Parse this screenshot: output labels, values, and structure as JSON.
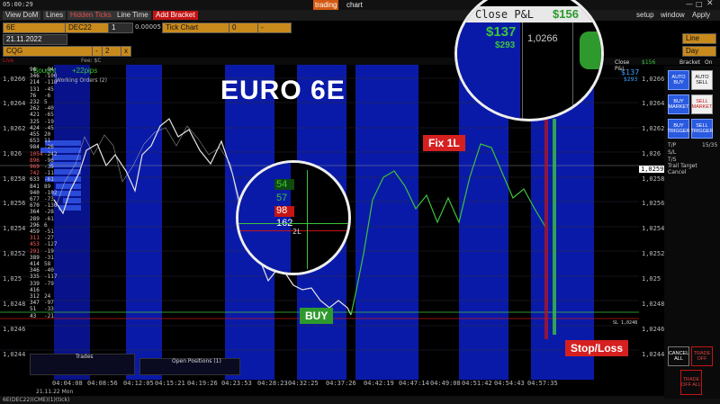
{
  "top": {
    "clock": "05:00:29",
    "brand_a": "trading",
    "brand_b": "chart"
  },
  "menu": {
    "tabs": [
      "View DoM",
      "Lines",
      "Hidden Ticks",
      "Line Time"
    ],
    "add_bracket": "Add Bracket",
    "right": [
      "setup",
      "window",
      "Apply"
    ]
  },
  "toolbar": {
    "symbol": "6E",
    "contract": "DEC22",
    "qty": "1",
    "tick_size": "0.00005",
    "chart_type": "Tick Chart",
    "offset": "0",
    "date": "21.11.2022",
    "account": "CQG",
    "dash": "-",
    "two": "2",
    "line_sel": "Line",
    "day_sel": "Day",
    "x_close": "x"
  },
  "status_line": {
    "live": "Live",
    "fee": "Fee: $C"
  },
  "chart": {
    "watermark": "EURO 6E",
    "bought_label": "Bought",
    "pips": "+22pips",
    "working_orders": "Working Orders (2)",
    "price_labels": [
      "1,0266",
      "1,0264",
      "1,0262",
      "1,026",
      "1,0258",
      "1,0256",
      "1,0254",
      "1,0252",
      "1,025",
      "1,0248",
      "1,0246",
      "1,0244"
    ],
    "current_price": "1,0259",
    "time_labels": [
      "04:04:08",
      "04:08:56",
      "04:12:05",
      "04:15:21",
      "04:19:26",
      "04:23:53",
      "04:28:23",
      "04:32:25",
      "04:37:26",
      "04:42:19",
      "04:47:14",
      "04:49:08",
      "04:51:42",
      "04:54:43",
      "04:57:35"
    ],
    "bottom_date": "21.11.22 Mon",
    "bottom_status": "6E(DEC22)(CME)(1)(tick)",
    "trades_label": "Trades",
    "open_positions": "Open Positions (1)",
    "close_pl_small": "Close P&L",
    "close_pl_small_val": "$156",
    "pl_small_a": "$137",
    "pl_small_b": "$293",
    "bracket_label": "Bracket",
    "on_label": "On",
    "stop_right": "SL 1,0248",
    "tp_right": "1,0248"
  },
  "dom": [
    {
      "p": "96",
      "v": "-94"
    },
    {
      "p": "346",
      "v": "-100"
    },
    {
      "p": "214",
      "v": "-118"
    },
    {
      "p": "131",
      "v": "-45"
    },
    {
      "p": "76",
      "v": "-6"
    },
    {
      "p": "232",
      "v": "5"
    },
    {
      "p": "262",
      "v": "-40"
    },
    {
      "p": "421",
      "v": "-65"
    },
    {
      "p": "325",
      "v": "-19"
    },
    {
      "p": "424",
      "v": "-45"
    },
    {
      "p": "455",
      "v": "20"
    },
    {
      "p": "653",
      "v": "11"
    },
    {
      "p": "984",
      "v": "-26"
    },
    {
      "p": "1054",
      "v": "-242"
    },
    {
      "p": "896",
      "v": "-96"
    },
    {
      "p": "969",
      "v": "-35"
    },
    {
      "p": "742",
      "v": "-11"
    },
    {
      "p": "633",
      "v": "-61"
    },
    {
      "p": "841",
      "v": "89"
    },
    {
      "p": "940",
      "v": "-102"
    },
    {
      "p": "677",
      "v": "-73"
    },
    {
      "p": "670",
      "v": "-130"
    },
    {
      "p": "364",
      "v": "-28"
    },
    {
      "p": "289",
      "v": "-61"
    },
    {
      "p": "296",
      "v": "6"
    },
    {
      "p": "459",
      "v": "-51"
    },
    {
      "p": "311",
      "v": "-27"
    },
    {
      "p": "453",
      "v": "-127"
    },
    {
      "p": "291",
      "v": "-19"
    },
    {
      "p": "389",
      "v": "-31"
    },
    {
      "p": "414",
      "v": "58"
    },
    {
      "p": "346",
      "v": "-40"
    },
    {
      "p": "335",
      "v": "-117"
    },
    {
      "p": "339",
      "v": "-79"
    },
    {
      "p": "416",
      "v": ""
    },
    {
      "p": "312",
      "v": "24"
    },
    {
      "p": "347",
      "v": "-97"
    },
    {
      "p": "51",
      "v": "-33"
    },
    {
      "p": "43",
      "v": "-21"
    }
  ],
  "zoom_top": {
    "close_pl": "Close P&L",
    "close_pl_val": "$156",
    "pl_a": "$137",
    "pl_b": "$293",
    "price": "1,0266"
  },
  "zoom_mid": {
    "v1": "54",
    "v2": "57",
    "v3": "98",
    "v4": "162",
    "tag": "2L"
  },
  "callouts": {
    "fix": "Fix 1L",
    "buy": "BUY",
    "stop": "Stop/Loss"
  },
  "side_panel": {
    "auto_buy": "AUTO BUY",
    "auto_sell": "AUTO SELL",
    "buy_market": "BUY MARKET",
    "sell_market": "SELL MARKET",
    "buy_trigger": "BUY TRIGGER",
    "sell_trigger": "SELL TRIGGER",
    "tp": "T/P",
    "sl": "S/L",
    "ts": "T/S",
    "trail": "Trail Target",
    "cancel": "Cancel",
    "tp_val": "15/35",
    "cancel_all": "CANCEL ALL",
    "trade_off": "TRADE OFF",
    "trade_off_all": "TRADE OFF ALL"
  },
  "colors": {
    "blue_band": "#0a1aa8",
    "buy_green": "#2e9a2e",
    "sell_red": "#c41414",
    "accent_orange": "#c98a1c",
    "trade_green": "#3cc43c"
  }
}
